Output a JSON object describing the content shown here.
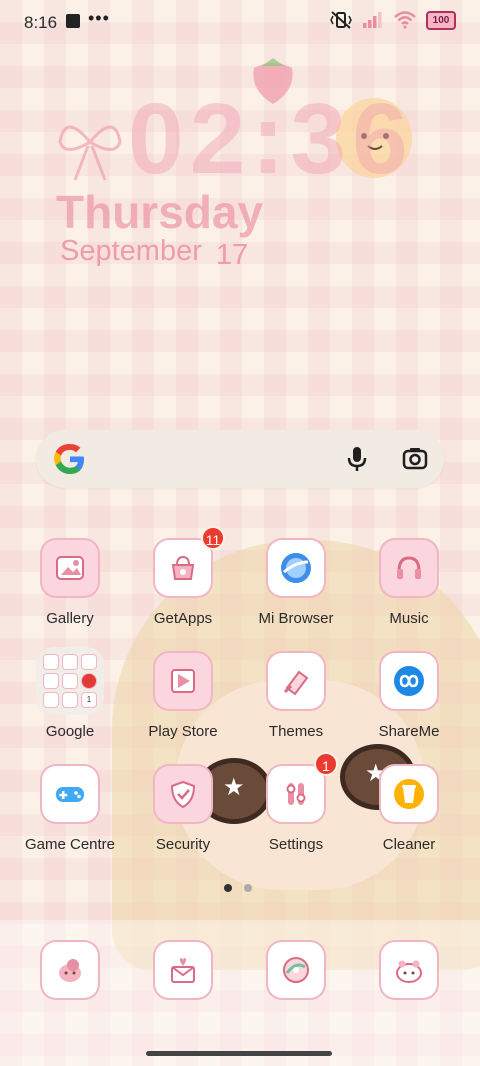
{
  "status_bar": {
    "time": "8:16",
    "dots": "•••",
    "battery": "100"
  },
  "lock_clock": {
    "time": "02:36",
    "weekday": "Thursday",
    "date_month": "September",
    "date_day": "17"
  },
  "apps": [
    {
      "label": "Gallery",
      "icon": "gallery-icon"
    },
    {
      "label": "GetApps",
      "icon": "getapps-icon",
      "badge": "11"
    },
    {
      "label": "Mi Browser",
      "icon": "browser-icon"
    },
    {
      "label": "Music",
      "icon": "music-icon"
    },
    {
      "label": "Google",
      "icon": "google-folder-icon"
    },
    {
      "label": "Play Store",
      "icon": "play-store-icon"
    },
    {
      "label": "Themes",
      "icon": "themes-icon"
    },
    {
      "label": "ShareMe",
      "icon": "shareme-icon"
    },
    {
      "label": "Game Centre",
      "icon": "game-controller-icon"
    },
    {
      "label": "Security",
      "icon": "security-icon"
    },
    {
      "label": "Settings",
      "icon": "settings-icon",
      "badge": "1"
    },
    {
      "label": "Cleaner",
      "icon": "cleaner-icon"
    }
  ],
  "google_folder_mini": [
    "",
    "",
    "",
    "",
    "",
    "",
    "",
    "",
    "1"
  ],
  "dock": [
    "phone-icon",
    "messages-icon",
    "camera-icon",
    "contacts-icon"
  ],
  "colors": {
    "accent": "#f1b6c3",
    "badge": "#ec3a31",
    "background": "#fbf1e6"
  }
}
